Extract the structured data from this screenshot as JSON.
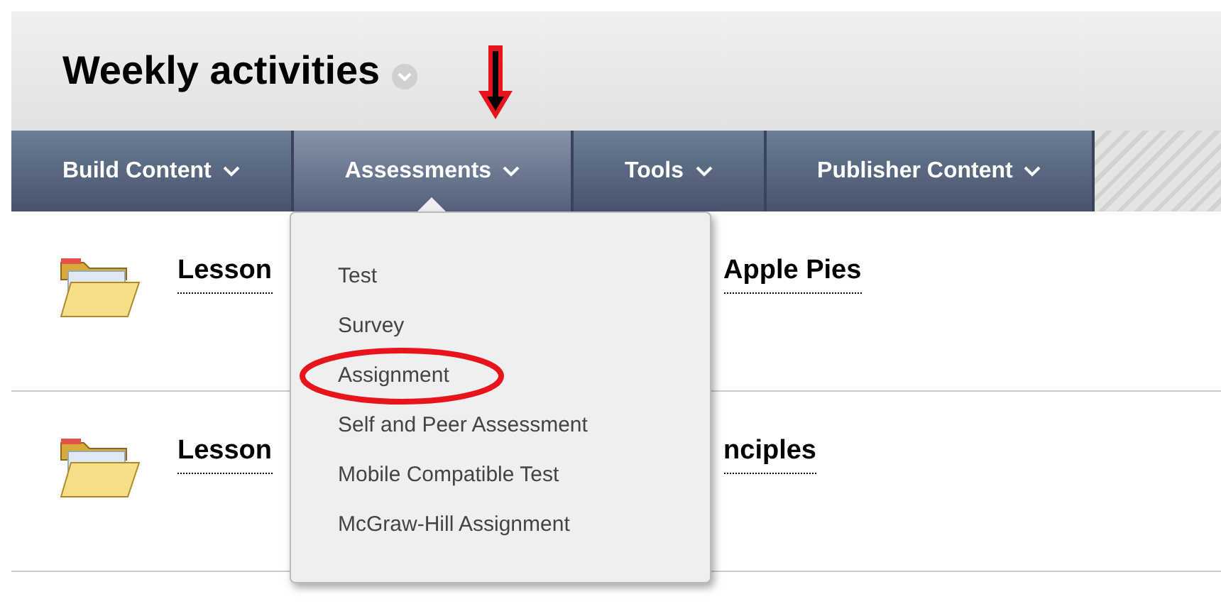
{
  "page_title": "Weekly activities",
  "nav": [
    {
      "label": "Build Content",
      "selected": false
    },
    {
      "label": "Assessments",
      "selected": true
    },
    {
      "label": "Tools",
      "selected": false
    },
    {
      "label": "Publisher Content",
      "selected": false
    }
  ],
  "menu": [
    {
      "label": "Test",
      "circled": false
    },
    {
      "label": "Survey",
      "circled": false
    },
    {
      "label": "Assignment",
      "circled": true
    },
    {
      "label": "Self and Peer Assessment",
      "circled": false
    },
    {
      "label": "Mobile Compatible Test",
      "circled": false
    },
    {
      "label": "McGraw-Hill Assignment",
      "circled": false
    }
  ],
  "items": [
    {
      "title_start": "Lesson",
      "title_end": "Apple Pies"
    },
    {
      "title_start": "Lesson",
      "title_end": "nciples"
    }
  ]
}
